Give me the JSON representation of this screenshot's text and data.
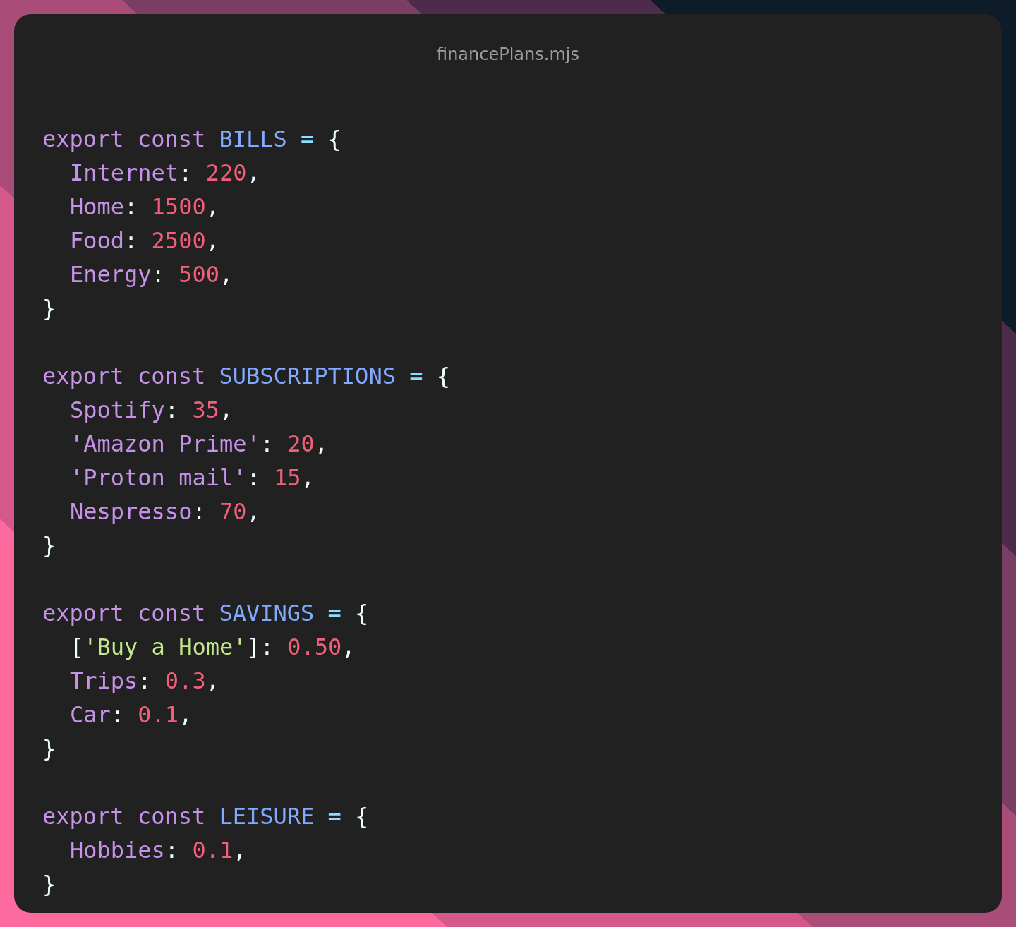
{
  "window": {
    "title": "financePlans.mjs"
  },
  "blocks": [
    {
      "head": [
        {
          "kind": "keyword",
          "text": "export const "
        },
        {
          "kind": "name",
          "text": "BILLS"
        },
        {
          "kind": "operator",
          "text": " = "
        },
        {
          "kind": "punct",
          "text": "{"
        }
      ],
      "children": [
        [
          {
            "kind": "prop",
            "text": "Internet"
          },
          {
            "kind": "punct",
            "text": ": "
          },
          {
            "kind": "number",
            "text": "220"
          },
          {
            "kind": "punct",
            "text": ","
          }
        ],
        [
          {
            "kind": "prop",
            "text": "Home"
          },
          {
            "kind": "punct",
            "text": ": "
          },
          {
            "kind": "number",
            "text": "1500"
          },
          {
            "kind": "punct",
            "text": ","
          }
        ],
        [
          {
            "kind": "prop",
            "text": "Food"
          },
          {
            "kind": "punct",
            "text": ": "
          },
          {
            "kind": "number",
            "text": "2500"
          },
          {
            "kind": "punct",
            "text": ","
          }
        ],
        [
          {
            "kind": "prop",
            "text": "Energy"
          },
          {
            "kind": "punct",
            "text": ": "
          },
          {
            "kind": "number",
            "text": "500"
          },
          {
            "kind": "punct",
            "text": ","
          }
        ]
      ],
      "tail": [
        {
          "kind": "punct",
          "text": "}"
        }
      ]
    },
    {
      "head": [
        {
          "kind": "keyword",
          "text": "export const "
        },
        {
          "kind": "name",
          "text": "SUBSCRIPTIONS"
        },
        {
          "kind": "operator",
          "text": " = "
        },
        {
          "kind": "punct",
          "text": "{"
        }
      ],
      "children": [
        [
          {
            "kind": "prop",
            "text": "Spotify"
          },
          {
            "kind": "punct",
            "text": ": "
          },
          {
            "kind": "number",
            "text": "35"
          },
          {
            "kind": "punct",
            "text": ","
          }
        ],
        [
          {
            "kind": "prop",
            "text": "'Amazon Prime'"
          },
          {
            "kind": "punct",
            "text": ": "
          },
          {
            "kind": "number",
            "text": "20"
          },
          {
            "kind": "punct",
            "text": ","
          }
        ],
        [
          {
            "kind": "prop",
            "text": "'Proton mail'"
          },
          {
            "kind": "punct",
            "text": ": "
          },
          {
            "kind": "number",
            "text": "15"
          },
          {
            "kind": "punct",
            "text": ","
          }
        ],
        [
          {
            "kind": "prop",
            "text": "Nespresso"
          },
          {
            "kind": "punct",
            "text": ": "
          },
          {
            "kind": "number",
            "text": "70"
          },
          {
            "kind": "punct",
            "text": ","
          }
        ]
      ],
      "tail": [
        {
          "kind": "punct",
          "text": "}"
        }
      ]
    },
    {
      "head": [
        {
          "kind": "keyword",
          "text": "export const "
        },
        {
          "kind": "name",
          "text": "SAVINGS"
        },
        {
          "kind": "operator",
          "text": " = "
        },
        {
          "kind": "punct",
          "text": "{"
        }
      ],
      "children": [
        [
          {
            "kind": "punct",
            "text": "["
          },
          {
            "kind": "string",
            "text": "'Buy a Home'"
          },
          {
            "kind": "punct",
            "text": "]: "
          },
          {
            "kind": "number",
            "text": "0.50"
          },
          {
            "kind": "punct",
            "text": ","
          }
        ],
        [
          {
            "kind": "prop",
            "text": "Trips"
          },
          {
            "kind": "punct",
            "text": ": "
          },
          {
            "kind": "number",
            "text": "0.3"
          },
          {
            "kind": "punct",
            "text": ","
          }
        ],
        [
          {
            "kind": "prop",
            "text": "Car"
          },
          {
            "kind": "punct",
            "text": ": "
          },
          {
            "kind": "number",
            "text": "0.1"
          },
          {
            "kind": "punct",
            "text": ","
          }
        ]
      ],
      "tail": [
        {
          "kind": "punct",
          "text": "}"
        }
      ]
    },
    {
      "head": [
        {
          "kind": "keyword",
          "text": "export const "
        },
        {
          "kind": "name",
          "text": "LEISURE"
        },
        {
          "kind": "operator",
          "text": " = "
        },
        {
          "kind": "punct",
          "text": "{"
        }
      ],
      "children": [
        [
          {
            "kind": "prop",
            "text": "Hobbies"
          },
          {
            "kind": "punct",
            "text": ": "
          },
          {
            "kind": "number",
            "text": "0.1"
          },
          {
            "kind": "punct",
            "text": ","
          }
        ]
      ],
      "tail": [
        {
          "kind": "punct",
          "text": "}"
        }
      ]
    }
  ]
}
